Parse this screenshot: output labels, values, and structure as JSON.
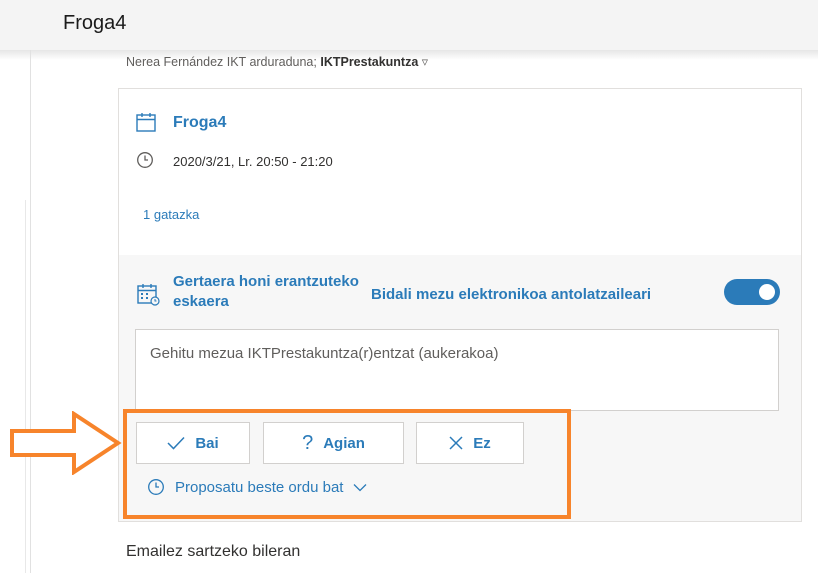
{
  "page": {
    "title": "Froga4",
    "recipients_text": "Nerea Fernández IKT arduraduna; ",
    "recipients_bold": "IKTPrestakuntza"
  },
  "event": {
    "title": "Froga4",
    "time": "2020/3/21, Lr. 20:50 - 21:20",
    "conflicts": "1 gatazka"
  },
  "response": {
    "request_label": "Gertaera honi erantzuteko eskaera",
    "send_email_label": "Bidali mezu elektronikoa antolatzaileari",
    "send_email_on": true,
    "message_placeholder": "Gehitu mezua IKTPrestakuntza(r)entzat (aukerakoa)",
    "buttons": {
      "yes": "Bai",
      "maybe": "Agian",
      "no": "Ez"
    },
    "propose_label": "Proposatu beste ordu bat"
  },
  "footer": {
    "text": "Emailez sartzeko bileran"
  },
  "colors": {
    "accent": "#2b7bb9",
    "highlight": "#f7842b"
  },
  "icons": [
    "calendar-icon",
    "clock-icon",
    "calendar-grid-icon",
    "check-icon",
    "question-icon",
    "x-icon",
    "chevron-down-icon",
    "arrow-right-icon"
  ]
}
